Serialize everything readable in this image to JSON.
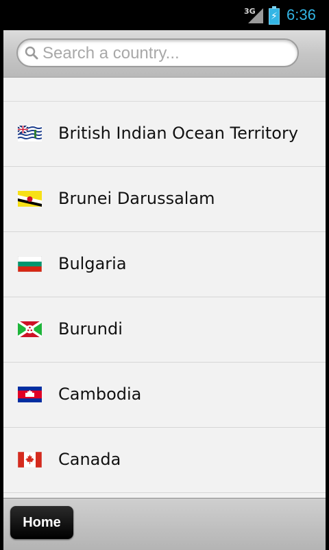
{
  "status_bar": {
    "network": "3G",
    "time": "6:36",
    "battery_color": "#33b5e5"
  },
  "search": {
    "placeholder": "Search a country...",
    "value": ""
  },
  "countries": [
    {
      "name": "British Indian Ocean Territory",
      "flag_icon": "flag-british-indian-ocean-territory-icon"
    },
    {
      "name": "Brunei Darussalam",
      "flag_icon": "flag-brunei-icon"
    },
    {
      "name": "Bulgaria",
      "flag_icon": "flag-bulgaria-icon"
    },
    {
      "name": "Burundi",
      "flag_icon": "flag-burundi-icon"
    },
    {
      "name": "Cambodia",
      "flag_icon": "flag-cambodia-icon"
    },
    {
      "name": "Canada",
      "flag_icon": "flag-canada-icon"
    }
  ],
  "bottom_bar": {
    "home_label": "Home"
  }
}
